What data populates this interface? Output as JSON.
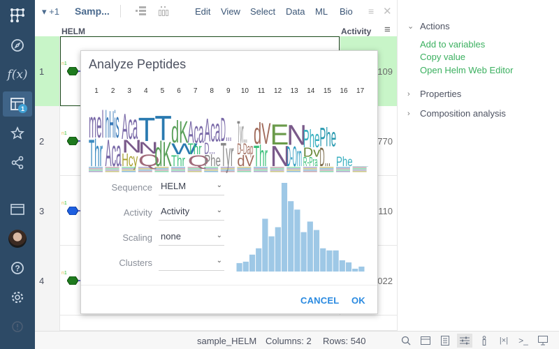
{
  "sidebar": {
    "items": [
      {
        "name": "logo-icon"
      },
      {
        "name": "compass-icon"
      },
      {
        "name": "function-icon",
        "label": "f(x)"
      },
      {
        "name": "tables-icon",
        "badge": "1"
      },
      {
        "name": "star-icon"
      },
      {
        "name": "share-icon"
      },
      {
        "name": "window-icon"
      },
      {
        "name": "avatar"
      },
      {
        "name": "help-icon"
      },
      {
        "name": "settings-icon"
      },
      {
        "name": "alert-icon"
      }
    ]
  },
  "toolbar": {
    "dropdown_label": "▾ +1",
    "table_name": "Samp...",
    "menu": [
      "Edit",
      "View",
      "Select",
      "Data",
      "ML",
      "Bio"
    ]
  },
  "grid": {
    "columns": [
      "HELM",
      "Activity"
    ],
    "rows": [
      {
        "num": "1",
        "activity": "109",
        "color": "#1e7a1e"
      },
      {
        "num": "2",
        "activity": "770",
        "color": "#1e7a1e"
      },
      {
        "num": "3",
        "activity": "110",
        "color": "#1e5fe0"
      },
      {
        "num": "4",
        "activity": "022",
        "color": "#1e7a1e"
      }
    ],
    "helm_label_n": "n",
    "helm_label_1": "1"
  },
  "right_panel": {
    "actions_title": "Actions",
    "actions": [
      "Add to variables",
      "Copy value",
      "Open Helm Web Editor"
    ],
    "properties_title": "Properties",
    "composition_title": "Composition analysis"
  },
  "dialog": {
    "title": "Analyze Peptides",
    "positions": [
      "1",
      "2",
      "3",
      "4",
      "5",
      "6",
      "7",
      "8",
      "9",
      "10",
      "11",
      "12",
      "13",
      "14",
      "15",
      "16",
      "17"
    ],
    "logo_columns": [
      [
        {
          "t": "mel",
          "c": "#7a6aa8"
        },
        {
          "t": "Thr",
          "c": "#3a8ac0"
        }
      ],
      [
        {
          "t": "hHis",
          "c": "#3a7ab8"
        },
        {
          "t": "Aca",
          "c": "#7a6aa8"
        }
      ],
      [
        {
          "t": "Aca",
          "c": "#7a6aa8"
        },
        {
          "t": "N",
          "c": "#7a5a8a"
        },
        {
          "t": "Hcy",
          "c": "#a8a030"
        }
      ],
      [
        {
          "t": "T",
          "c": "#2a7ab0"
        },
        {
          "t": "N",
          "c": "#7a5a8a"
        },
        {
          "t": "Q",
          "c": "#a06a7a"
        }
      ],
      [
        {
          "t": "T",
          "c": "#2a7ab0"
        },
        {
          "t": "dK",
          "c": "#5aa05a"
        }
      ],
      [
        {
          "t": "dK",
          "c": "#5aa05a"
        },
        {
          "t": "W",
          "c": "#2a7ab0"
        },
        {
          "t": "Thr",
          "c": "#3ac07a"
        }
      ],
      [
        {
          "t": "Aca",
          "c": "#7a6aa8"
        },
        {
          "t": "Thr",
          "c": "#3ac07a"
        },
        {
          "t": "Q",
          "c": "#a06a7a"
        }
      ],
      [
        {
          "t": "Aca",
          "c": "#7a6aa8"
        },
        {
          "t": "D...",
          "c": "#7a6aa8"
        },
        {
          "t": "Phe",
          "c": "#888"
        }
      ],
      [
        {
          "t": "D...",
          "c": "#7a6aa8"
        },
        {
          "t": "Tyr",
          "c": "#888"
        }
      ],
      [
        {
          "t": "Tyr...",
          "c": "#888"
        },
        {
          "t": "D-Dap",
          "c": "#a06a5a"
        },
        {
          "t": "dV",
          "c": "#a06a5a"
        }
      ],
      [
        {
          "t": "dV",
          "c": "#a06a5a"
        },
        {
          "t": "Thr",
          "c": "#3ac07a"
        }
      ],
      [
        {
          "t": "E",
          "c": "#6a9a4a"
        },
        {
          "t": "N",
          "c": "#7a5a8a"
        }
      ],
      [
        {
          "t": "N",
          "c": "#7a5a8a"
        },
        {
          "t": "D-Orn",
          "c": "#2a9ac0"
        }
      ],
      [
        {
          "t": "Phe",
          "c": "#3ab0c0"
        },
        {
          "t": "Dv",
          "c": "#6a8a3a"
        },
        {
          "t": "R-Pra",
          "c": "#3ac07a"
        }
      ],
      [
        {
          "t": "Phe",
          "c": "#2a9ab0"
        },
        {
          "t": "D...",
          "c": "#7a6a4a"
        }
      ],
      [
        {
          "t": "Phe",
          "c": "#3ab0c0"
        }
      ],
      [
        {
          "t": "___",
          "c": "#2a9ab0"
        }
      ]
    ],
    "form": {
      "sequence_label": "Sequence",
      "sequence_value": "HELM",
      "activity_label": "Activity",
      "activity_value": "Activity",
      "scaling_label": "Scaling",
      "scaling_value": "none",
      "clusters_label": "Clusters",
      "clusters_value": ""
    },
    "cancel_label": "CANCEL",
    "ok_label": "OK"
  },
  "chart_data": {
    "type": "bar",
    "title": "",
    "xlabel": "",
    "ylabel": "",
    "bar_color": "#9ec8e6",
    "values": [
      12,
      14,
      24,
      33,
      75,
      50,
      63,
      126,
      100,
      88,
      56,
      71,
      59,
      33,
      30,
      30,
      16,
      13,
      4,
      7
    ],
    "ylim": [
      0,
      126
    ]
  },
  "statusbar": {
    "table": "sample_HELM",
    "columns": "Columns: 2",
    "rows": "Rows: 540",
    "icons": [
      "search-icon",
      "layout-icon",
      "form-icon",
      "settings-sliders-icon",
      "info-icon",
      "column-icon",
      "terminal-icon",
      "presentation-icon"
    ]
  }
}
